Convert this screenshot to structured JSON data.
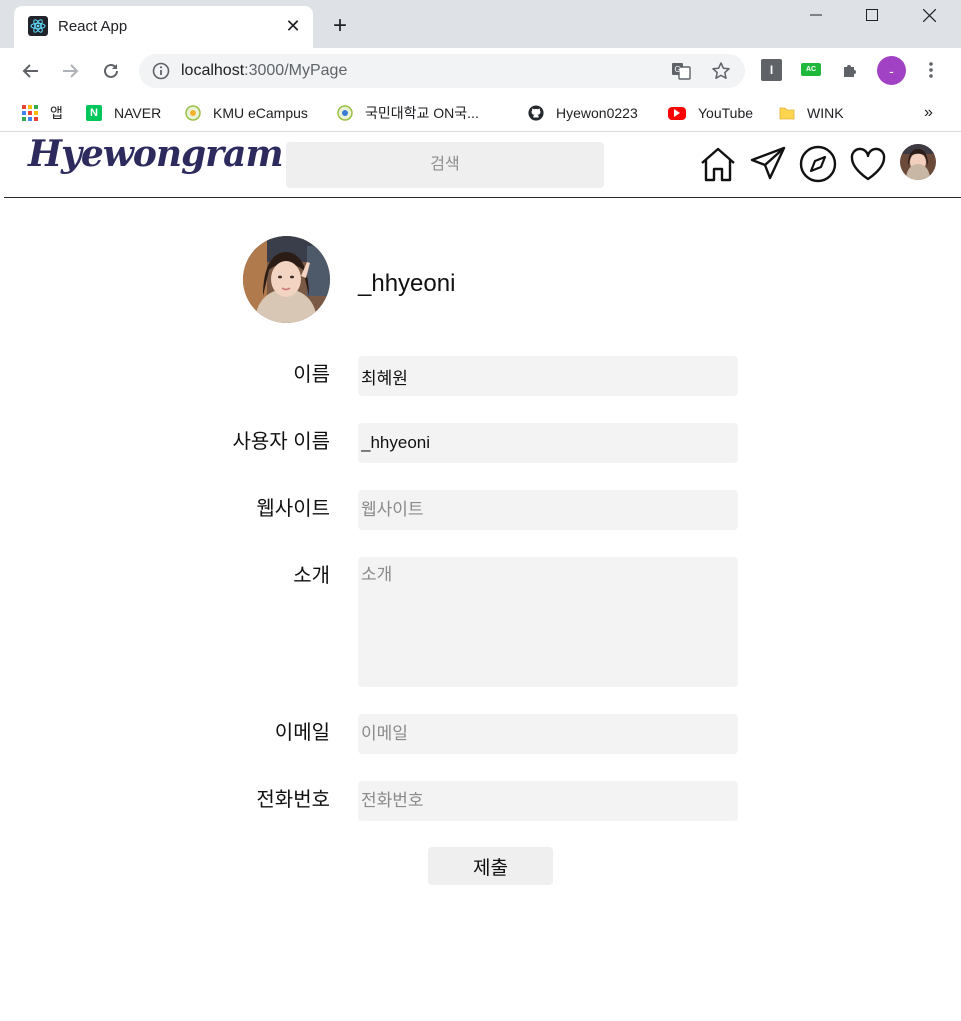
{
  "browser": {
    "tab_title": "React App",
    "tab_close": "✕",
    "new_tab": "+",
    "url_host": "localhost",
    "url_rest": ":3000/MyPage",
    "profile_initial": "-",
    "ext_1_label": "I",
    "ext_2_label": "AC"
  },
  "bookmarks": {
    "items": [
      {
        "label": "앱",
        "icon": "apps-grid-icon"
      },
      {
        "label": "NAVER",
        "icon": "naver-icon"
      },
      {
        "label": "KMU eCampus",
        "icon": "kmu-icon"
      },
      {
        "label": "국민대학교 ON국...",
        "icon": "kmu-on-icon"
      },
      {
        "label": "Hyewon0223",
        "icon": "github-icon"
      },
      {
        "label": "YouTube",
        "icon": "youtube-icon"
      },
      {
        "label": "WINK",
        "icon": "folder-icon"
      }
    ],
    "more": "»"
  },
  "app": {
    "logo": "Hyewongram",
    "search_placeholder": "검색"
  },
  "profile": {
    "username": "_hhyeoni"
  },
  "form": {
    "name_label": "이름",
    "name_value": "최혜원",
    "username_label": "사용자 이름",
    "username_value": "_hhyeoni",
    "website_label": "웹사이트",
    "website_placeholder": "웹사이트",
    "bio_label": "소개",
    "bio_placeholder": "소개",
    "email_label": "이메일",
    "email_placeholder": "이메일",
    "phone_label": "전화번호",
    "phone_placeholder": "전화번호",
    "submit_label": "제출"
  },
  "colors": {
    "logo": "#2d2b5e",
    "input_bg": "#f3f3f3",
    "profile_badge": "#a142c4"
  }
}
